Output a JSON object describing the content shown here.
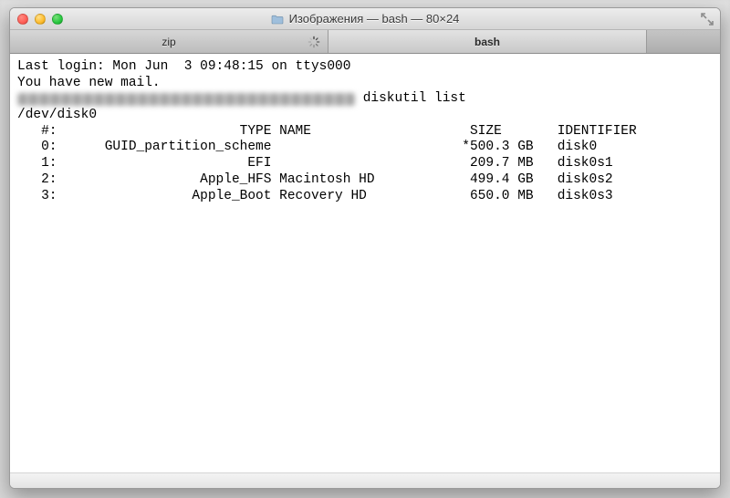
{
  "window": {
    "title": "Изображения — bash — 80×24"
  },
  "tabs": {
    "items": [
      {
        "label": "zip",
        "active": false,
        "busy": true
      },
      {
        "label": "bash",
        "active": true,
        "busy": false
      }
    ]
  },
  "terminal": {
    "last_login": "Last login: Mon Jun  3 09:48:15 on ttys000",
    "mail_notice": "You have new mail.",
    "command": " diskutil list",
    "device": "/dev/disk0",
    "header": "   #:                       TYPE NAME                    SIZE       IDENTIFIER",
    "rows": [
      "   0:      GUID_partition_scheme                        *500.3 GB   disk0",
      "   1:                        EFI                         209.7 MB   disk0s1",
      "   2:                  Apple_HFS Macintosh HD            499.4 GB   disk0s2",
      "   3:                 Apple_Boot Recovery HD             650.0 MB   disk0s3"
    ]
  }
}
